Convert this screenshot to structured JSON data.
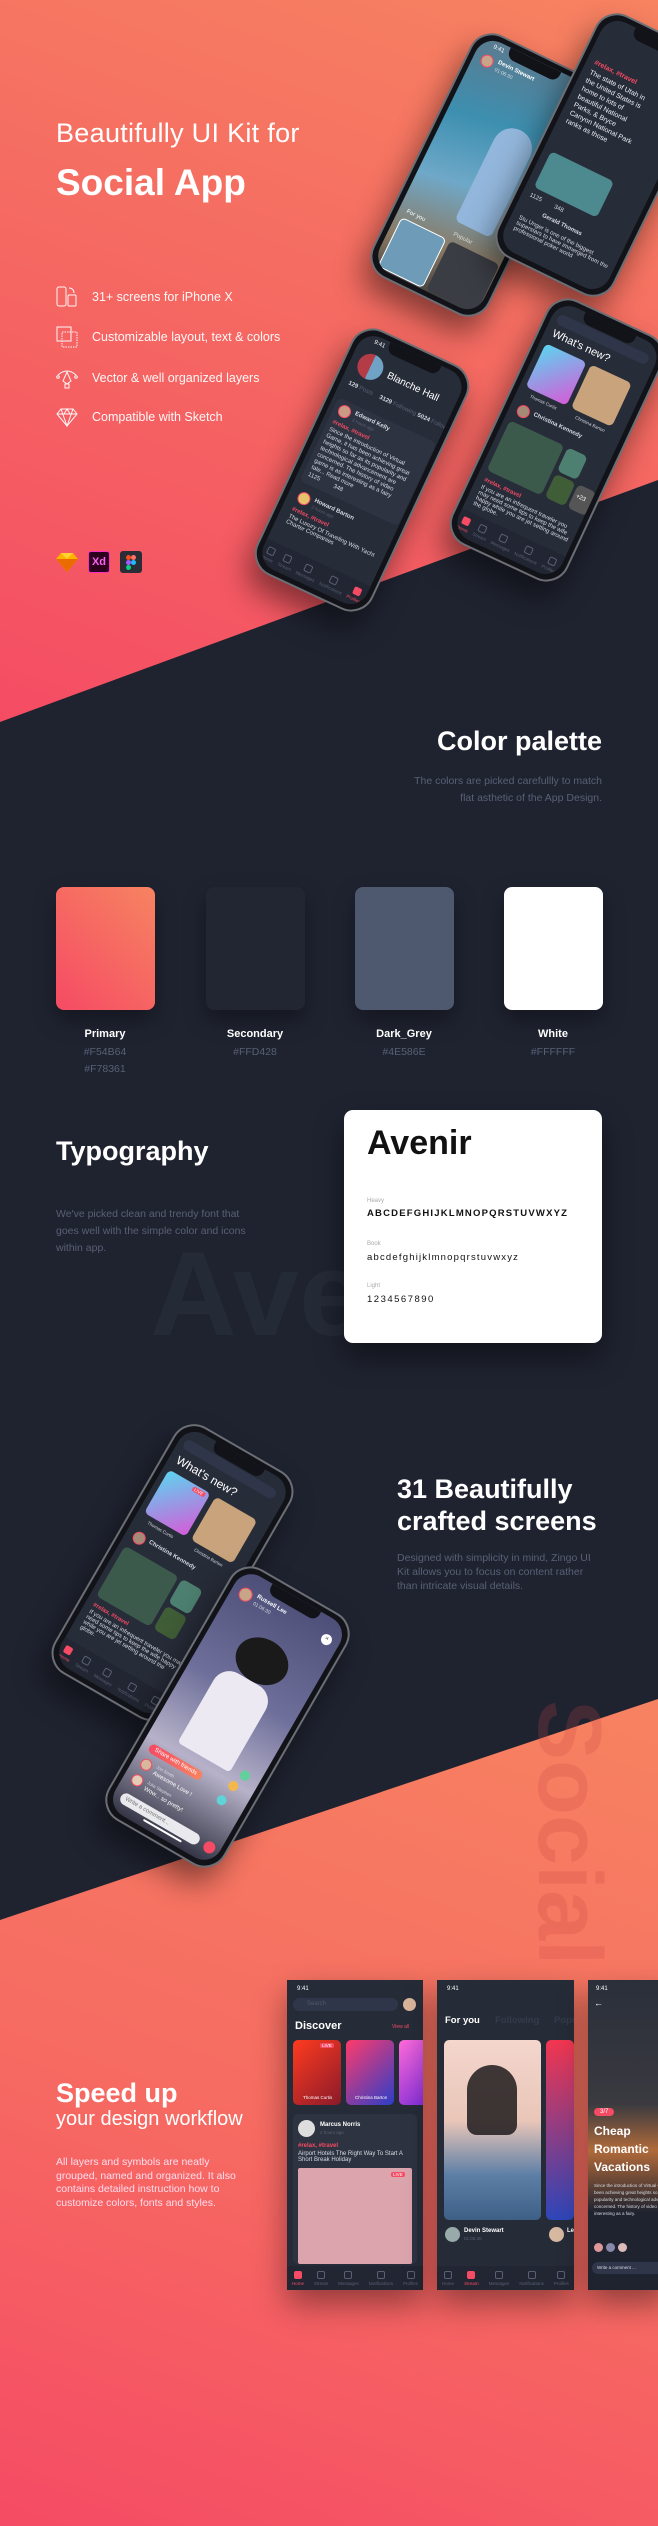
{
  "hero": {
    "subtitle": "Beautifully UI Kit for",
    "title": "Social App",
    "features": [
      {
        "icon": "devices-icon",
        "label": "31+ screens for iPhone X"
      },
      {
        "icon": "layers-icon",
        "label": "Customizable layout, text & colors"
      },
      {
        "icon": "vector-pen-icon",
        "label": "Vector & well organized layers"
      },
      {
        "icon": "sketch-diamond-icon",
        "label": "Compatible with Sketch"
      }
    ],
    "tools": [
      {
        "icon": "sketch-icon"
      },
      {
        "icon": "adobe-xd-icon",
        "label": "Xd"
      },
      {
        "icon": "figma-icon"
      }
    ]
  },
  "palette": {
    "title": "Color palette",
    "desc_line1": "The colors are picked carefullly to match",
    "desc_line2": "flat asthetic of the App Design.",
    "swatches": [
      {
        "name": "Primary",
        "hex1": "#F54B64",
        "hex2": "#F78361"
      },
      {
        "name": "Secondary",
        "hex1": "#FFD428",
        "color": "#222632"
      },
      {
        "name": "Dark_Grey",
        "hex1": "#4E586E",
        "color": "#4E586E"
      },
      {
        "name": "White",
        "hex1": "#FFFFFF",
        "color": "#FFFFFF"
      }
    ]
  },
  "typography": {
    "title": "Typography",
    "desc_line1": "We've picked clean and trendy font that",
    "desc_line2": "goes well with the simple color and icons",
    "desc_line3": "within app.",
    "font_name": "Avenir",
    "watermark": "Avenir",
    "weights": [
      {
        "label": "Heavy",
        "sample": "ABCDEFGHIJKLMNOPQRSTUVWXYZ"
      },
      {
        "label": "Book",
        "sample": "abcdefghijklmnopqrstuvwxyz"
      },
      {
        "label": "Light",
        "sample": "1234567890"
      }
    ]
  },
  "screens": {
    "title_line1": "31 Beautifully",
    "title_line2": "crafted screens",
    "desc_line1": "Designed with simplicity in mind, Zingo UI",
    "desc_line2": "Kit allows you to focus on content rather",
    "desc_line3": "than intricate visual details.",
    "watermark": "Social"
  },
  "speed": {
    "title": "Speed up",
    "subtitle": "your design workflow",
    "desc_line1": "All layers and symbols are neatly",
    "desc_line2": "grouped, named and organized. It also",
    "desc_line3": "contains detailed instruction how to",
    "desc_line4": "customize colors, fonts and styles."
  },
  "app": {
    "time": "9:41",
    "tabs": [
      "Home",
      "Stream",
      "Messages",
      "Notifications",
      "Profiles"
    ],
    "tag": "#relax, #travel",
    "stream": {
      "user": "Devin Stewart",
      "duration": "01:06:30",
      "for_you": "For you",
      "popular": "Popular"
    },
    "profile": {
      "name": "Blanche Hall",
      "posts": "129",
      "posts_label": "Posts",
      "following": "3129",
      "following_label": "Following",
      "followers": "5024",
      "followers_label": "Followers",
      "post_user": "Edward Kelly",
      "post_time": "2 hours ago",
      "post_text": "Since the introduction of Virtual Game, it has been achieving great heights so far as its popularity and technological advancement are concerned. The history of video game is as interesting as a fairy tale... Read more",
      "likes": "1125",
      "comments": "348",
      "post2_user": "Howard Barton",
      "post2_time": "2 hours ago",
      "post2_text": "The Luxury Of Traveling With Yacht Charter Companies"
    },
    "whatsnew": {
      "title": "What's new?",
      "search": "Search",
      "live": "LIVE",
      "story1": "Thomas Curtis",
      "story2": "Christina Barton",
      "post_user": "Christina Kennedy",
      "post_time": "2 hours ago",
      "more": "+23",
      "post_text": "If you are an infrequent traveler you may need some tips to keep the wife happy while you are jet setting around the globe."
    },
    "feed": {
      "post_text": "The state of Utah in the United States is home to lots of beautiful National Parks, & Bryce Canyon National Park ranks as those",
      "likes": "1125",
      "comments": "348",
      "user2": "Gerald Thomas",
      "user2_time": "2 hours ago",
      "post2_text": "Stu Unger is one of the biggest superstars to have immerged from the professional poker world"
    },
    "live": {
      "user": "Russell Lee",
      "duration": "01:06:30",
      "share": "Share with friends",
      "c1_user": "Jon Smith",
      "c1_text": "Awesome Love !",
      "c2_user": "Julia Stephen",
      "c2_text": "Wow... so pretty!",
      "comment_placeholder": "Write a comment..."
    },
    "discover": {
      "search": "Search",
      "title": "Discover",
      "view_all": "View all",
      "live": "LIVE",
      "story1": "Thomas Curtis",
      "story2": "Christina Barton",
      "post_user": "Marcus Norris",
      "post_time": "2 hours ago",
      "post_text": "Airport Hotels The Right Way To Start A Short Break Holiday"
    },
    "foryou": {
      "tab1": "For you",
      "tab2": "Following",
      "tab3": "Popular",
      "user": "Devin Stewart",
      "duration": "01:06:30",
      "user2": "Le"
    },
    "article": {
      "counter": "3/7",
      "title_line1": "Cheap",
      "title_line2": "Romantic",
      "title_line3": "Vacations",
      "text": "Since the introduction of Virtual Game, it has been achieving great heights so far as its popularity and technological advancement are concerned. The history of video game is as interesting as a fairy.",
      "comment_placeholder": "Write a comment ..."
    }
  },
  "colors": {
    "primary": "#F54B64",
    "primary_end": "#F78361",
    "secondary": "#222632",
    "dark_grey": "#4E586E",
    "white": "#FFFFFF"
  }
}
